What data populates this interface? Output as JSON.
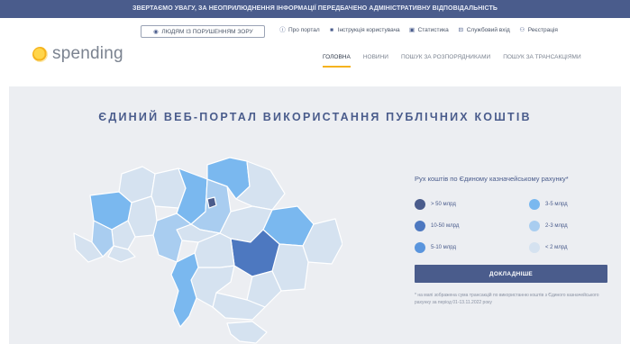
{
  "notice": "ЗВЕРТАЄМО УВАГУ, ЗА НЕОПРИЛЮДНЕННЯ ІНФОРМАЦІЇ ПЕРЕДБАЧЕНО АДМІНІСТРАТИВНУ ВІДПОВІДАЛЬНІСТЬ",
  "logo_text": "spending",
  "impaired_button": "ЛЮДЯМ ІЗ ПОРУШЕННЯМ ЗОРУ",
  "top_links": [
    {
      "label": "Про портал",
      "icon": "info-icon"
    },
    {
      "label": "Інструкція користувача",
      "icon": "book-icon"
    },
    {
      "label": "Статистика",
      "icon": "chart-icon"
    },
    {
      "label": "Службовий вхід",
      "icon": "login-icon"
    },
    {
      "label": "Реєстрація",
      "icon": "user-add-icon"
    }
  ],
  "nav": [
    "ГОЛОВНА",
    "НОВИНИ",
    "ПОШУК ЗА РОЗПОРЯДНИКАМИ",
    "ПОШУК ЗА ТРАНСАКЦІЯМИ"
  ],
  "nav_active": "ГОЛОВНА",
  "hero_title": "ЄДИНИЙ ВЕБ-ПОРТАЛ ВИКОРИСТАННЯ ПУБЛІЧНИХ КОШТІВ",
  "legend_title": "Рух коштів по Єдиному казначейському рахунку*",
  "legend": [
    {
      "label": "> 50 млрд",
      "color": "#4a5c8c"
    },
    {
      "label": "3-5 млрд",
      "color": "#7ab8ef"
    },
    {
      "label": "10-50 млрд",
      "color": "#4d78c0"
    },
    {
      "label": "2-3 млрд",
      "color": "#a9cdf0"
    },
    {
      "label": "5-10 млрд",
      "color": "#5a95dd"
    },
    {
      "label": "< 2 млрд",
      "color": "#d5e2f0"
    }
  ],
  "details_button": "ДОКЛАДНІШЕ",
  "footnote": "* на мапі зображена сума трансакцій по використанню коштів з Єдиного казначейського рахунку за період 01-13.11.2022 року",
  "colors": {
    "primary": "#4a5c8c",
    "accent": "#f5b31e",
    "hero_bg": "#eceef2"
  }
}
